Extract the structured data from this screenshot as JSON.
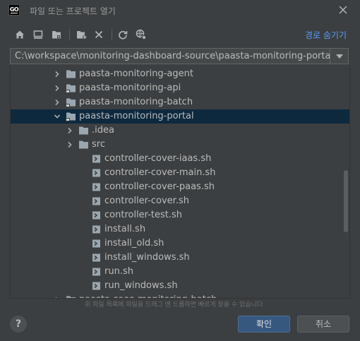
{
  "window": {
    "logo": "GO",
    "title": "파일 또는 프로젝트 열기",
    "close_icon": "close-icon"
  },
  "toolbar": {
    "icons": [
      "home-icon",
      "desktop-icon",
      "project-folder-icon",
      "new-folder-icon",
      "delete-icon",
      "refresh-icon",
      "show-hidden-icon"
    ],
    "hide_path_label": "경로 숨기기"
  },
  "path": {
    "value": "C:\\workspace\\monitoring-dashboard-source\\paasta-monitoring-portal"
  },
  "tree": {
    "items": [
      {
        "label": "paasta-monitoring-agent",
        "icon": "folder-icon",
        "expanded": false
      },
      {
        "label": "paasta-monitoring-api",
        "icon": "module-folder-icon",
        "expanded": false
      },
      {
        "label": "paasta-monitoring-batch",
        "icon": "module-folder-icon",
        "expanded": false
      },
      {
        "label": "paasta-monitoring-portal",
        "icon": "module-folder-icon",
        "expanded": true
      },
      {
        "label": ".idea",
        "icon": "folder-icon",
        "expanded": false
      },
      {
        "label": "src",
        "icon": "folder-icon",
        "expanded": false
      },
      {
        "label": "controller-cover-iaas.sh",
        "icon": "shell-script-icon"
      },
      {
        "label": "controller-cover-main.sh",
        "icon": "shell-script-icon"
      },
      {
        "label": "controller-cover-paas.sh",
        "icon": "shell-script-icon"
      },
      {
        "label": "controller-cover.sh",
        "icon": "shell-script-icon"
      },
      {
        "label": "controller-test.sh",
        "icon": "shell-script-icon"
      },
      {
        "label": "install.sh",
        "icon": "shell-script-icon"
      },
      {
        "label": "install_old.sh",
        "icon": "shell-script-icon"
      },
      {
        "label": "install_windows.sh",
        "icon": "shell-script-icon"
      },
      {
        "label": "run.sh",
        "icon": "shell-script-icon"
      },
      {
        "label": "run_windows.sh",
        "icon": "shell-script-icon"
      },
      {
        "label": "paasta-saas-monitoring-batch",
        "icon": "module-folder-icon",
        "expanded": false
      }
    ],
    "hint": "위 파일 목록에 파일을 드래그 앤 드롭하면 빠르게 찾을 수 있습니다"
  },
  "buttons": {
    "help": "?",
    "ok": "확인",
    "cancel": "취소"
  },
  "colors": {
    "background": "#3c3f41",
    "selection": "#0d293e",
    "link": "#589df6",
    "primary_button": "#365880"
  }
}
